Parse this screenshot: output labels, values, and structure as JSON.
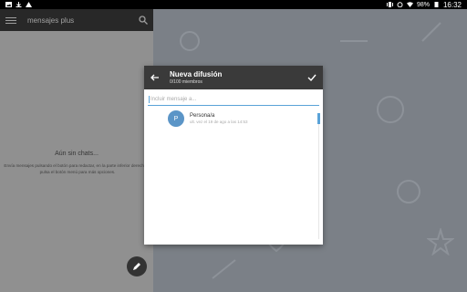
{
  "status_bar": {
    "battery": "98%",
    "time": "16:32"
  },
  "left_pane": {
    "title": "mensajes plus",
    "empty_title": "Aún sin chats...",
    "empty_desc": "Envía mensajes pulsando el botón para redactar, en la parte inferior derecha, o pulsa el botón menú para más opciones."
  },
  "dialog": {
    "title": "Nueva difusión",
    "subtitle": "0/100 miembros",
    "input_placeholder": "Incluir mensaje a...",
    "contacts": [
      {
        "initial": "P",
        "name": "Persona/a",
        "status": "ult. vez el 19 de ago a las 14:53"
      }
    ]
  }
}
